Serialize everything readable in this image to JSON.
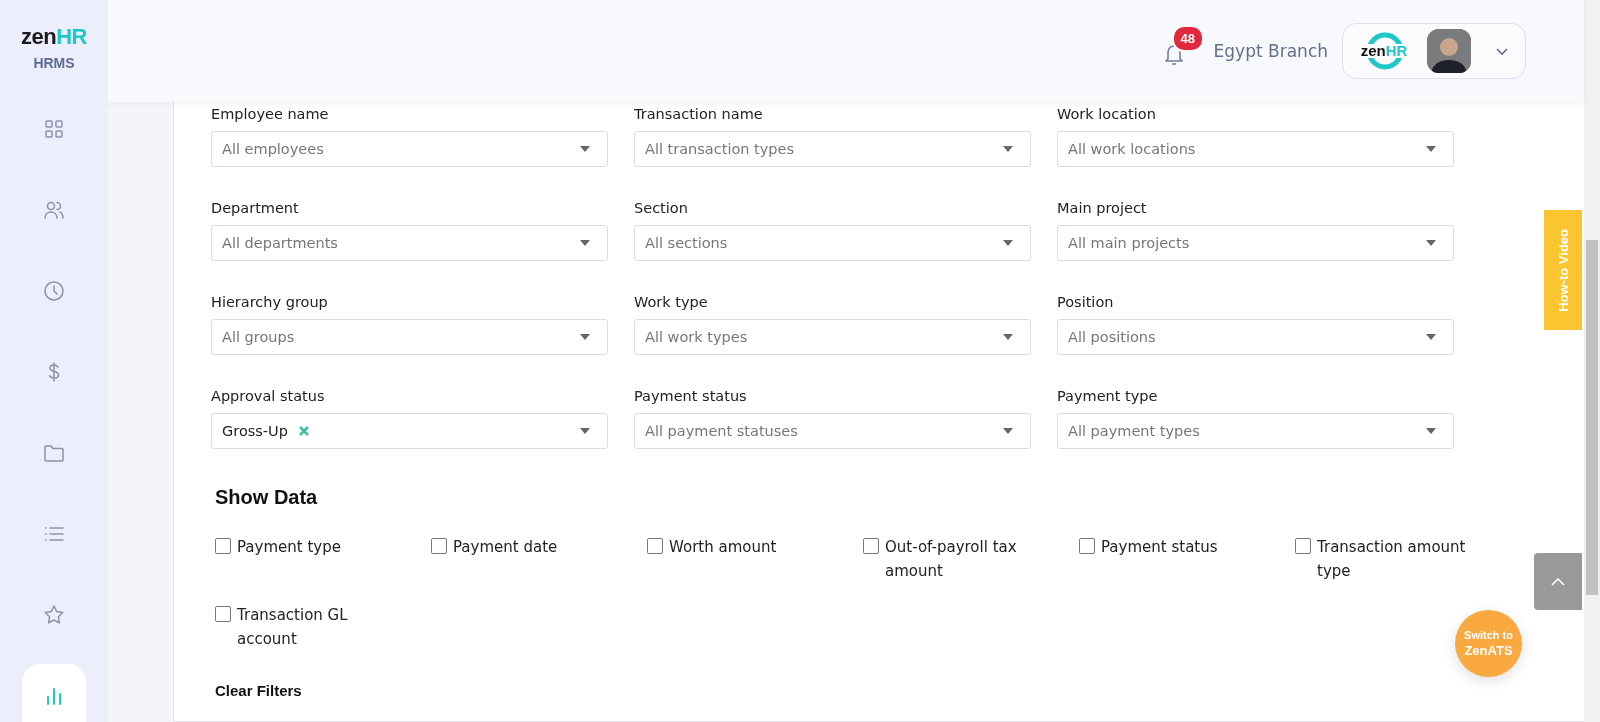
{
  "brand": {
    "logo_left": "zen",
    "logo_right": "HR",
    "product": "HRMS"
  },
  "sidebar": {
    "items": [
      {
        "kind": "grid",
        "selected": false
      },
      {
        "kind": "people",
        "selected": false
      },
      {
        "kind": "clock",
        "selected": false
      },
      {
        "kind": "dollar",
        "selected": false
      },
      {
        "kind": "folder",
        "selected": false
      },
      {
        "kind": "list",
        "selected": false
      },
      {
        "kind": "star",
        "selected": false
      },
      {
        "kind": "chart",
        "selected": true
      }
    ]
  },
  "header": {
    "notification_count": "48",
    "branch": "Egypt Branch",
    "account_logo_left": "zen",
    "account_logo_right": "HR"
  },
  "filters": [
    {
      "label": "Employee name",
      "placeholder": "All employees"
    },
    {
      "label": "Transaction name",
      "placeholder": "All transaction types"
    },
    {
      "label": "Work location",
      "placeholder": "All work locations"
    },
    {
      "label": "Department",
      "placeholder": "All departments"
    },
    {
      "label": "Section",
      "placeholder": "All sections"
    },
    {
      "label": "Main project",
      "placeholder": "All main projects"
    },
    {
      "label": "Hierarchy group",
      "placeholder": "All groups"
    },
    {
      "label": "Work type",
      "placeholder": "All work types"
    },
    {
      "label": "Position",
      "placeholder": "All positions"
    },
    {
      "label": "Approval status",
      "value": "Gross-Up"
    },
    {
      "label": "Payment status",
      "placeholder": "All payment statuses"
    },
    {
      "label": "Payment type",
      "placeholder": "All payment types"
    }
  ],
  "show_data": {
    "title": "Show Data",
    "options": [
      {
        "label": "Payment type",
        "checked": false
      },
      {
        "label": "Payment date",
        "checked": false
      },
      {
        "label": "Worth amount",
        "checked": false
      },
      {
        "label": "Out-of-payroll tax amount",
        "checked": false
      },
      {
        "label": "Payment status",
        "checked": false
      },
      {
        "label": "Transaction amount type",
        "checked": false
      },
      {
        "label": "Transaction GL account",
        "checked": false
      }
    ]
  },
  "clear_filters": "Clear Filters",
  "how_to_video": "How-to Video",
  "switch_button": {
    "line_1": "Switch to",
    "line_2": "ZenATS"
  }
}
